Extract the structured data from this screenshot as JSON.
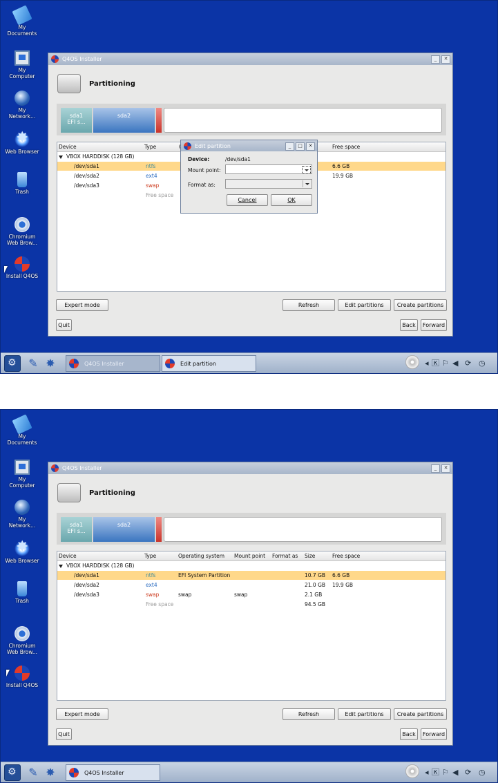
{
  "desktop": {
    "icons": [
      {
        "label": "My Documents",
        "icon": "documents-icon"
      },
      {
        "label": "My Computer",
        "icon": "computer-icon"
      },
      {
        "label": "My Network...",
        "icon": "network-icon"
      },
      {
        "label": "Web Browser",
        "icon": "web-browser-icon"
      },
      {
        "label": "Trash",
        "icon": "trash-icon"
      },
      {
        "label": "Chromium Web Brow...",
        "icon": "chromium-icon"
      },
      {
        "label": "Install Q4OS",
        "icon": "install-q4os-icon"
      }
    ]
  },
  "installer": {
    "title": "Q4OS Installer",
    "section_title": "Partitioning",
    "partition_bar": {
      "sda1": {
        "name": "sda1",
        "sub": "EFI s..."
      },
      "sda2": {
        "name": "sda2"
      }
    },
    "columns": [
      "Device",
      "Type",
      "Operating system",
      "Mount point",
      "Format as",
      "Size",
      "Free space"
    ],
    "disk": "VBOX HARDDISK (128 GB)",
    "rows": [
      {
        "device": "/dev/sda1",
        "type": "ntfs",
        "os": "EFI System Partition",
        "mount": "",
        "format": "",
        "size": "10.7 GB",
        "free": "6.6 GB"
      },
      {
        "device": "/dev/sda2",
        "type": "ext4",
        "os": "",
        "mount": "",
        "format": "",
        "size": "21.0 GB",
        "free": "19.9 GB"
      },
      {
        "device": "/dev/sda3",
        "type": "swap",
        "os": "swap",
        "mount": "swap",
        "format": "",
        "size": "2.1 GB",
        "free": ""
      },
      {
        "device": "",
        "type": "Free space",
        "os": "",
        "mount": "",
        "format": "",
        "size": "94.5 GB",
        "free": ""
      }
    ],
    "buttons": {
      "expert": "Expert mode",
      "refresh": "Refresh",
      "edit": "Edit partitions",
      "create": "Create partitions",
      "quit": "Quit",
      "back": "Back",
      "forward": "Forward"
    }
  },
  "dialog": {
    "title": "Edit partition",
    "device_label": "Device:",
    "device_value": "/dev/sda1",
    "mount_label": "Mount point:",
    "format_label": "Format as:",
    "cancel": "Cancel",
    "ok": "OK"
  },
  "taskbar": {
    "task_installer": "Q4OS Installer",
    "task_dialog": "Edit partition"
  }
}
